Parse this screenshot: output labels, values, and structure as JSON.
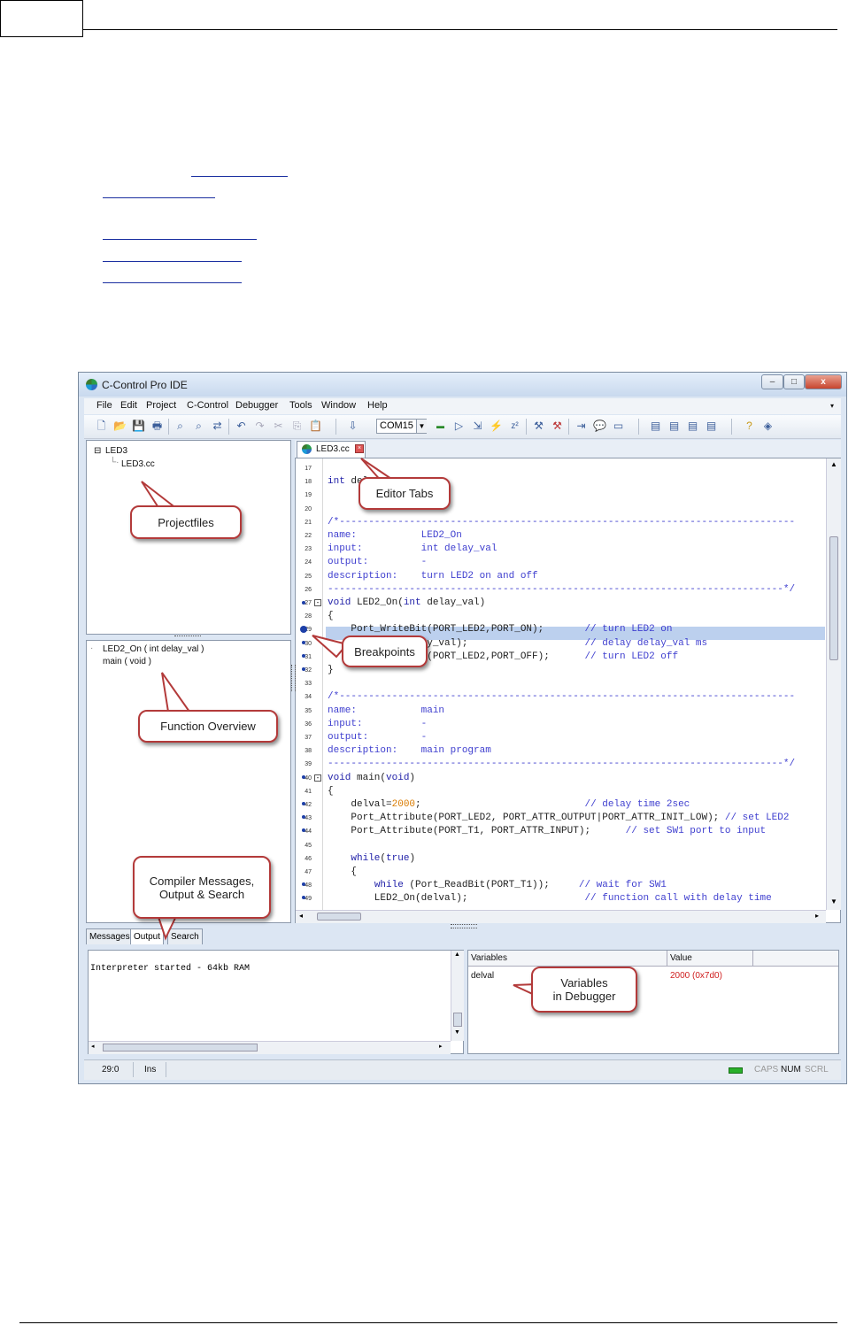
{
  "window": {
    "title": "C-Control Pro IDE",
    "minimize": "–",
    "maximize": "□",
    "close": "x"
  },
  "menu": [
    "File",
    "Edit",
    "Project",
    "C-Control",
    "Debugger",
    "Tools",
    "Window",
    "Help"
  ],
  "toolbar": {
    "port": "COM15"
  },
  "project_tree": {
    "root": "LED3",
    "file": "LED3.cc"
  },
  "function_list": [
    "LED2_On ( int delay_val )",
    "main ( void )"
  ],
  "editor": {
    "tab": "LED3.cc",
    "lines": [
      {
        "n": "17",
        "code": ""
      },
      {
        "n": "18",
        "code": "int delval;"
      },
      {
        "n": "19",
        "code": ""
      },
      {
        "n": "20",
        "code": ""
      },
      {
        "n": "21",
        "code": "/*------------------------------------------------------------------------------"
      },
      {
        "n": "22",
        "code": "name:           LED2_On"
      },
      {
        "n": "23",
        "code": "input:          int delay_val"
      },
      {
        "n": "24",
        "code": "output:         -"
      },
      {
        "n": "25",
        "code": "description:    turn LED2 on and off"
      },
      {
        "n": "26",
        "code": "------------------------------------------------------------------------------*/"
      },
      {
        "n": "27",
        "code": "void LED2_On(int delay_val)"
      },
      {
        "n": "28",
        "code": "{"
      },
      {
        "n": "29",
        "code": "    Port_WriteBit(PORT_LED2,PORT_ON);       // turn LED2 on"
      },
      {
        "n": "30",
        "code": "    AbsDelay(delay_val);                    // delay delay_val ms"
      },
      {
        "n": "31",
        "code": "    Port_WriteBit(PORT_LED2,PORT_OFF);      // turn LED2 off"
      },
      {
        "n": "32",
        "code": "}"
      },
      {
        "n": "33",
        "code": ""
      },
      {
        "n": "34",
        "code": "/*------------------------------------------------------------------------------"
      },
      {
        "n": "35",
        "code": "name:           main"
      },
      {
        "n": "36",
        "code": "input:          -"
      },
      {
        "n": "37",
        "code": "output:         -"
      },
      {
        "n": "38",
        "code": "description:    main program"
      },
      {
        "n": "39",
        "code": "------------------------------------------------------------------------------*/"
      },
      {
        "n": "40",
        "code": "void main(void)"
      },
      {
        "n": "41",
        "code": "{"
      },
      {
        "n": "42",
        "code": "    delval=2000;                            // delay time 2sec"
      },
      {
        "n": "43",
        "code": "    Port_Attribute(PORT_LED2, PORT_ATTR_OUTPUT|PORT_ATTR_INIT_LOW); // set LED2"
      },
      {
        "n": "44",
        "code": "    Port_Attribute(PORT_T1, PORT_ATTR_INPUT);      // set SW1 port to input"
      },
      {
        "n": "45",
        "code": ""
      },
      {
        "n": "46",
        "code": "    while(true)"
      },
      {
        "n": "47",
        "code": "    {"
      },
      {
        "n": "48",
        "code": "        while (Port_ReadBit(PORT_T1));     // wait for SW1"
      },
      {
        "n": "49",
        "code": "        LED2_On(delval);                    // function call with delay time"
      }
    ]
  },
  "bottom_tabs": [
    "Messages",
    "Output",
    "Search"
  ],
  "output_text": "Interpreter started - 64kb RAM",
  "variables": {
    "col_name": "Variables",
    "col_value": "Value",
    "name": "delval",
    "value": "2000 (0x7d0)"
  },
  "status": {
    "pos": "29:0",
    "mode": "Ins",
    "caps": "CAPS",
    "num": "NUM",
    "scrl": "SCRL"
  },
  "callouts": {
    "editor_tabs": "Editor Tabs",
    "projectfiles": "Projectfiles",
    "breakpoints": "Breakpoints",
    "function_overview": "Function Overview",
    "compiler_l1": "Compiler Messages,",
    "compiler_l2": "Output & Search",
    "variables_l1": "Variables",
    "variables_l2": "in Debugger"
  },
  "colors": {
    "accent_red": "#b33a3a",
    "link_blue": "#1a2fa0",
    "highlight": "#bcd0ee"
  }
}
